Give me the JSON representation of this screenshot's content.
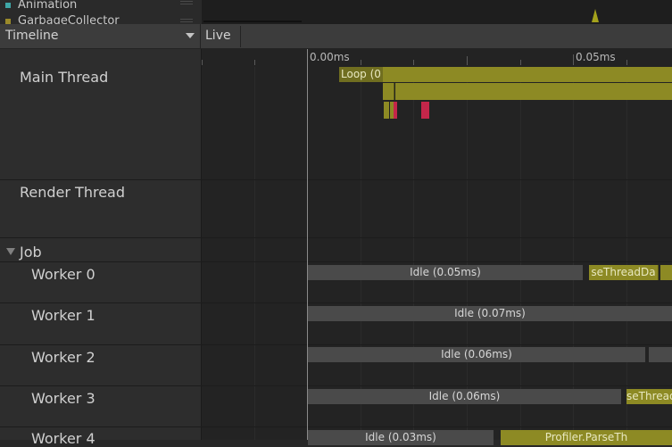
{
  "legend": {
    "items": [
      {
        "label": "Animation",
        "color": "#3fa7a7"
      },
      {
        "label": "GarbageCollector",
        "color": "#9a8a2a"
      }
    ]
  },
  "header": {
    "view_label": "Timeline",
    "live_label": "Live"
  },
  "ruler": {
    "labels": [
      "0.00ms",
      "0.05ms"
    ]
  },
  "threads": {
    "main": {
      "label": "Main Thread",
      "top_bar": "Loop (0"
    },
    "render": {
      "label": "Render Thread"
    },
    "job_group": {
      "label": "Job"
    },
    "workers": [
      {
        "label": "Worker 0",
        "idle": "Idle (0.05ms)",
        "task": "seThreadDa"
      },
      {
        "label": "Worker 1",
        "idle": "Idle (0.07ms)"
      },
      {
        "label": "Worker 2",
        "idle": "Idle (0.06ms)"
      },
      {
        "label": "Worker 3",
        "idle": "Idle (0.06ms)",
        "task": "seThread"
      },
      {
        "label": "Worker 4",
        "idle": "Idle (0.03ms)",
        "task": "Profiler.ParseTh"
      }
    ]
  },
  "colors": {
    "idle": "#4a4a4a",
    "task": "#8d8a24",
    "marker": "#c4264a"
  }
}
